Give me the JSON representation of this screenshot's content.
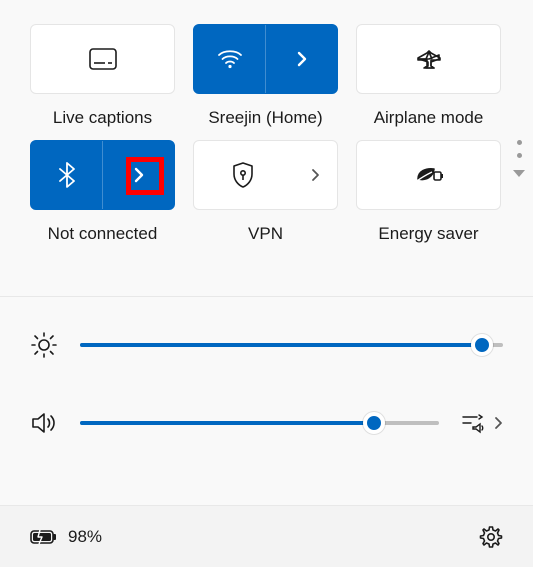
{
  "accent": "#0067c0",
  "highlight": "#ff0000",
  "tiles": {
    "live_captions": {
      "label": "Live captions",
      "active": false
    },
    "wifi": {
      "label": "Sreejin (Home)",
      "active": true
    },
    "airplane": {
      "label": "Airplane mode",
      "active": false
    },
    "bluetooth": {
      "label": "Not connected",
      "active": true
    },
    "vpn": {
      "label": "VPN",
      "active": false
    },
    "energy_saver": {
      "label": "Energy saver",
      "active": false
    }
  },
  "sliders": {
    "brightness": {
      "value": 95
    },
    "volume": {
      "value": 82
    }
  },
  "footer": {
    "battery_text": "98%"
  }
}
